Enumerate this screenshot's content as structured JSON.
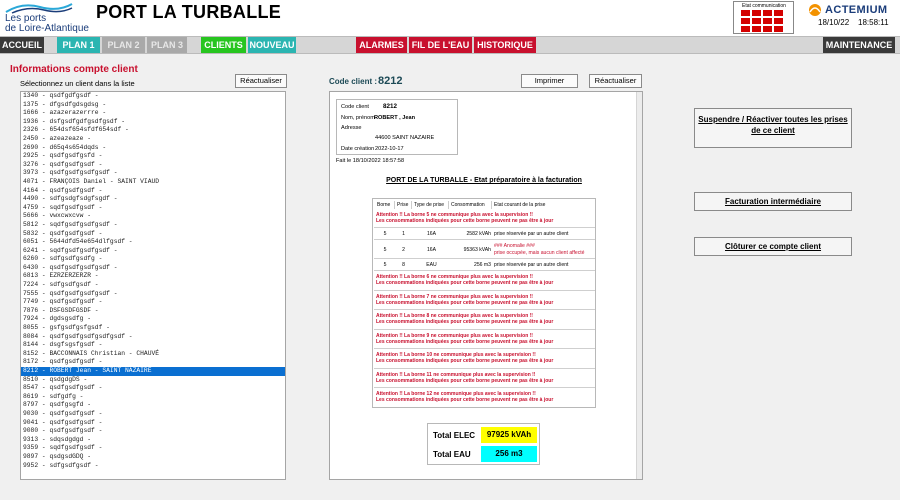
{
  "header": {
    "logo_line1": "Les ports",
    "logo_line2": "de Loire-Atlantique",
    "title": "PORT LA TURBALLE",
    "comm_label": "Etat communication",
    "comm_status_color": "#d40000",
    "brand": "ACTEMIUM",
    "date": "18/10/22",
    "time": "18:58:11"
  },
  "nav": {
    "accueil": "ACCUEIL",
    "plan1": "PLAN 1",
    "plan2": "PLAN 2",
    "plan3": "PLAN 3",
    "clients": "CLIENTS",
    "nouveau": "NOUVEAU",
    "alarmes": "ALARMES",
    "fil_eau": "FIL DE L'EAU",
    "historique": "HISTORIQUE",
    "maintenance": "MAINTENANCE"
  },
  "left": {
    "section_title": "Informations compte client",
    "select_label": "Sélectionnez un client dans la liste",
    "refresh_label": "Réactualiser",
    "selected_index": 29,
    "clients": [
      "1340 - qsdfgdfgsdf  -",
      "1375 - dfgsdfgdsgdsg  -",
      "1666 - azazerazerrre  -",
      "1936 - dsfgsdfgdfgsdfgsdf  -",
      "2326 - 654dsf654sfdf654sdf  -",
      "2450 - azeazeaze  -",
      "2690 - d65q4s654dqds  -",
      "2925 - qsdfgsdfgsfd  -",
      "3276 - qsdfgsdfgsdf  -",
      "3973 - qsdfgsdfgsdfgsdf  -",
      "4071 - FRANÇOIS Daniel - SAINT VIAUD",
      "4164 - qsdfgsdfgsdf  -",
      "4490 - sdfgsdgfsdgfsgdf  -",
      "4759 - sqdfgsdfgsdf  -",
      "5666 - vwxcwxcvw  -",
      "5812 - sqdfgsdfgsdfgsdf  -",
      "5832 - qsdfgsdfgsdf  -",
      "6051 - 5644dfd54e654dlfgsdf  -",
      "6241 - sqdfgsdfgsdfgsdf  -",
      "6260 - sdfgsdfgsdfg  -",
      "6430 - qsdfgsdfgsdfgsdf  -",
      "6813 - EZRZERZERZR  -",
      "7224 - sdfgsdfgsdf  -",
      "7555 - qsdfgsdfgsdfgsdf  -",
      "7749 - qsdfgsdfgsdf  -",
      "7876 - DSFGSDFGSDF  -",
      "7924 - dgdsgsdfg  -",
      "8055 - gsfgsdfgsfgsdf  -",
      "8084 - qsdfgsdfgsdfgsdfgsdf  -",
      "8144 - dsgfsgsfgsdf  -",
      "8152 - BACCONNAIS Christian - CHAUVÉ",
      "8172 - qsdfgsdfgsdf  -",
      "8212 - ROBERT Jean - SAINT NAZAIRE",
      "8510 - qsdgdgDS  -",
      "8547 - qsdfgsdfgsdf  -",
      "8619 - sdfgdfg  -",
      "8797 - qsdfgsgfd  -",
      "9030 - qsdfgsdfgsdf  -",
      "9041 - qsdfgsdfgsdf  -",
      "9080 - qsdfgsdfgsdf  -",
      "9313 - sdqsdgdgd  -",
      "9359 - sqdfgsdfgsdf  -",
      "9897 - qsdgsdGDQ  -",
      "9952 - sdfgsdfgsdf  -"
    ]
  },
  "middle": {
    "code_label": "Code client :",
    "code_value": "8212",
    "print_label": "Imprimer",
    "refresh_label": "Réactualiser",
    "info": {
      "code_label": "Code client",
      "code_value": "8212",
      "name_label": "Nom, prénom",
      "name_value": "ROBERT , Jean",
      "address_label": "Adresse",
      "address_value": "44600 SAINT NAZAIRE",
      "created_label": "Date création",
      "created_value": "2022-10-17"
    },
    "made_on": "Fait le 18/10/2022 18:57:58",
    "doc_title": "PORT DE LA TURBALLE - Etat préparatoire à la facturation",
    "table_headers": [
      "Borne",
      "Prise",
      "Type de prise",
      "Consommation",
      "Etat courant de la prise"
    ],
    "alert_line2": "Les consommations indiquées pour cette borne peuvent ne pas être à jour",
    "alert5": "Attention !! La borne 5 ne communique plus avec la supervision !!",
    "rows": [
      {
        "borne": "5",
        "prise": "1",
        "type": "16A",
        "conso": "2582 kVAh",
        "etat": "prise réservée par un autre client",
        "etat2": ""
      },
      {
        "borne": "5",
        "prise": "2",
        "type": "16A",
        "conso": "95363 kVAh",
        "etat": "### Anomalie ###",
        "etat2": "prise occupée, mais aucun client affecté"
      },
      {
        "borne": "5",
        "prise": "8",
        "type": "EAU",
        "conso": "256 m3",
        "etat": "prise réservée par un autre client",
        "etat2": ""
      }
    ],
    "alerts": [
      "Attention !! La borne 6 ne communique plus avec la supervision !!",
      "Attention !! La borne 7 ne communique plus avec la supervision !!",
      "Attention !! La borne 8 ne communique plus avec la supervision !!",
      "Attention !! La borne 9 ne communique plus avec la supervision !!",
      "Attention !! La borne 10 ne communique plus avec la supervision !!",
      "Attention !! La borne 11 ne communique plus avec la supervision !!",
      "Attention !! La borne 12 ne communique plus avec la supervision !!"
    ],
    "totals": {
      "elec_label": "Total ELEC",
      "elec_value": "97925 kVAh",
      "elec_color": "#ffff00",
      "eau_label": "Total EAU",
      "eau_value": "256 m3",
      "eau_color": "#00ffff"
    }
  },
  "right": {
    "suspend_label": "Suspendre / Réactiver toutes les prises de ce client",
    "billing_label": "Facturation intermédiaire",
    "close_label": "Clôturer ce compte client"
  }
}
